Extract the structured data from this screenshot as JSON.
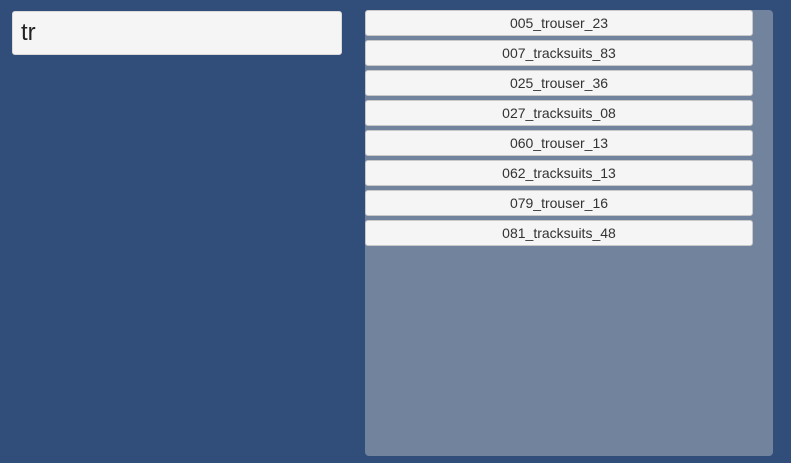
{
  "search": {
    "value": "tr"
  },
  "results": {
    "items": [
      {
        "label": "005_trouser_23"
      },
      {
        "label": "007_tracksuits_83"
      },
      {
        "label": "025_trouser_36"
      },
      {
        "label": "027_tracksuits_08"
      },
      {
        "label": "060_trouser_13"
      },
      {
        "label": "062_tracksuits_13"
      },
      {
        "label": "079_trouser_16"
      },
      {
        "label": "081_tracksuits_48"
      }
    ]
  },
  "colors": {
    "background": "#314d79",
    "panel": "#72839e",
    "item": "#f5f5f5",
    "text": "#333333"
  }
}
